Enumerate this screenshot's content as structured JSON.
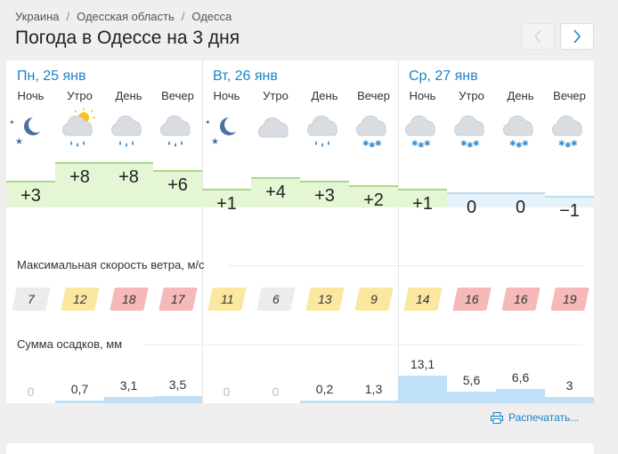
{
  "breadcrumb": [
    "Украина",
    "Одесская область",
    "Одесса"
  ],
  "title": "Погода в Одессе на 3 дня",
  "print_label": "Распечатать...",
  "days": [
    {
      "title": "Пн, 25 янв"
    },
    {
      "title": "Вт, 26 янв"
    },
    {
      "title": "Ср, 27 янв"
    }
  ],
  "parts": [
    {
      "label": "Ночь",
      "icon": "moon-stars-icon",
      "temp": "+3",
      "temp_value": 3,
      "wind": "7",
      "precip": "0",
      "precip_value": 0
    },
    {
      "label": "Утро",
      "icon": "sun-cloud-rain-icon",
      "temp": "+8",
      "temp_value": 8,
      "wind": "12",
      "precip": "0,7",
      "precip_value": 0.7
    },
    {
      "label": "День",
      "icon": "cloud-rain-icon",
      "temp": "+8",
      "temp_value": 8,
      "wind": "18",
      "precip": "3,1",
      "precip_value": 3.1
    },
    {
      "label": "Вечер",
      "icon": "cloud-rain-icon",
      "temp": "+6",
      "temp_value": 6,
      "wind": "17",
      "precip": "3,5",
      "precip_value": 3.5
    },
    {
      "label": "Ночь",
      "icon": "moon-stars-icon",
      "temp": "+1",
      "temp_value": 1,
      "wind": "11",
      "precip": "0",
      "precip_value": 0
    },
    {
      "label": "Утро",
      "icon": "cloud-icon",
      "temp": "+4",
      "temp_value": 4,
      "wind": "6",
      "precip": "0",
      "precip_value": 0
    },
    {
      "label": "День",
      "icon": "cloud-rain-icon",
      "temp": "+3",
      "temp_value": 3,
      "wind": "13",
      "precip": "0,2",
      "precip_value": 0.2
    },
    {
      "label": "Вечер",
      "icon": "cloud-snow-icon",
      "temp": "+2",
      "temp_value": 2,
      "wind": "9",
      "precip": "1,3",
      "precip_value": 1.3
    },
    {
      "label": "Ночь",
      "icon": "cloud-snow-icon",
      "temp": "+1",
      "temp_value": 1,
      "wind": "14",
      "precip": "13,1",
      "precip_value": 13.1
    },
    {
      "label": "Утро",
      "icon": "cloud-snow-icon",
      "temp": "0",
      "temp_value": 0,
      "wind": "16",
      "precip": "5,6",
      "precip_value": 5.6
    },
    {
      "label": "День",
      "icon": "cloud-snow-icon",
      "temp": "0",
      "temp_value": 0,
      "wind": "16",
      "precip": "6,6",
      "precip_value": 6.6
    },
    {
      "label": "Вечер",
      "icon": "cloud-snow-icon",
      "temp": "−1",
      "temp_value": -1,
      "wind": "19",
      "precip": "3",
      "precip_value": 3
    }
  ],
  "wind_title": "Максимальная скорость ветра, м/с",
  "precip_title": "Сумма осадков, мм",
  "colors": {
    "accent": "#1a84c5",
    "temp_warm": "#e4f6d4",
    "temp_warm_line": "#a9d98a",
    "temp_cold": "#e6f3fb",
    "temp_cold_line": "#bcdcf0",
    "wind_low": "#ececec",
    "wind_mid": "#fbe8a0",
    "wind_high": "#f6b8b8",
    "precip": "#bfe0f7"
  }
}
